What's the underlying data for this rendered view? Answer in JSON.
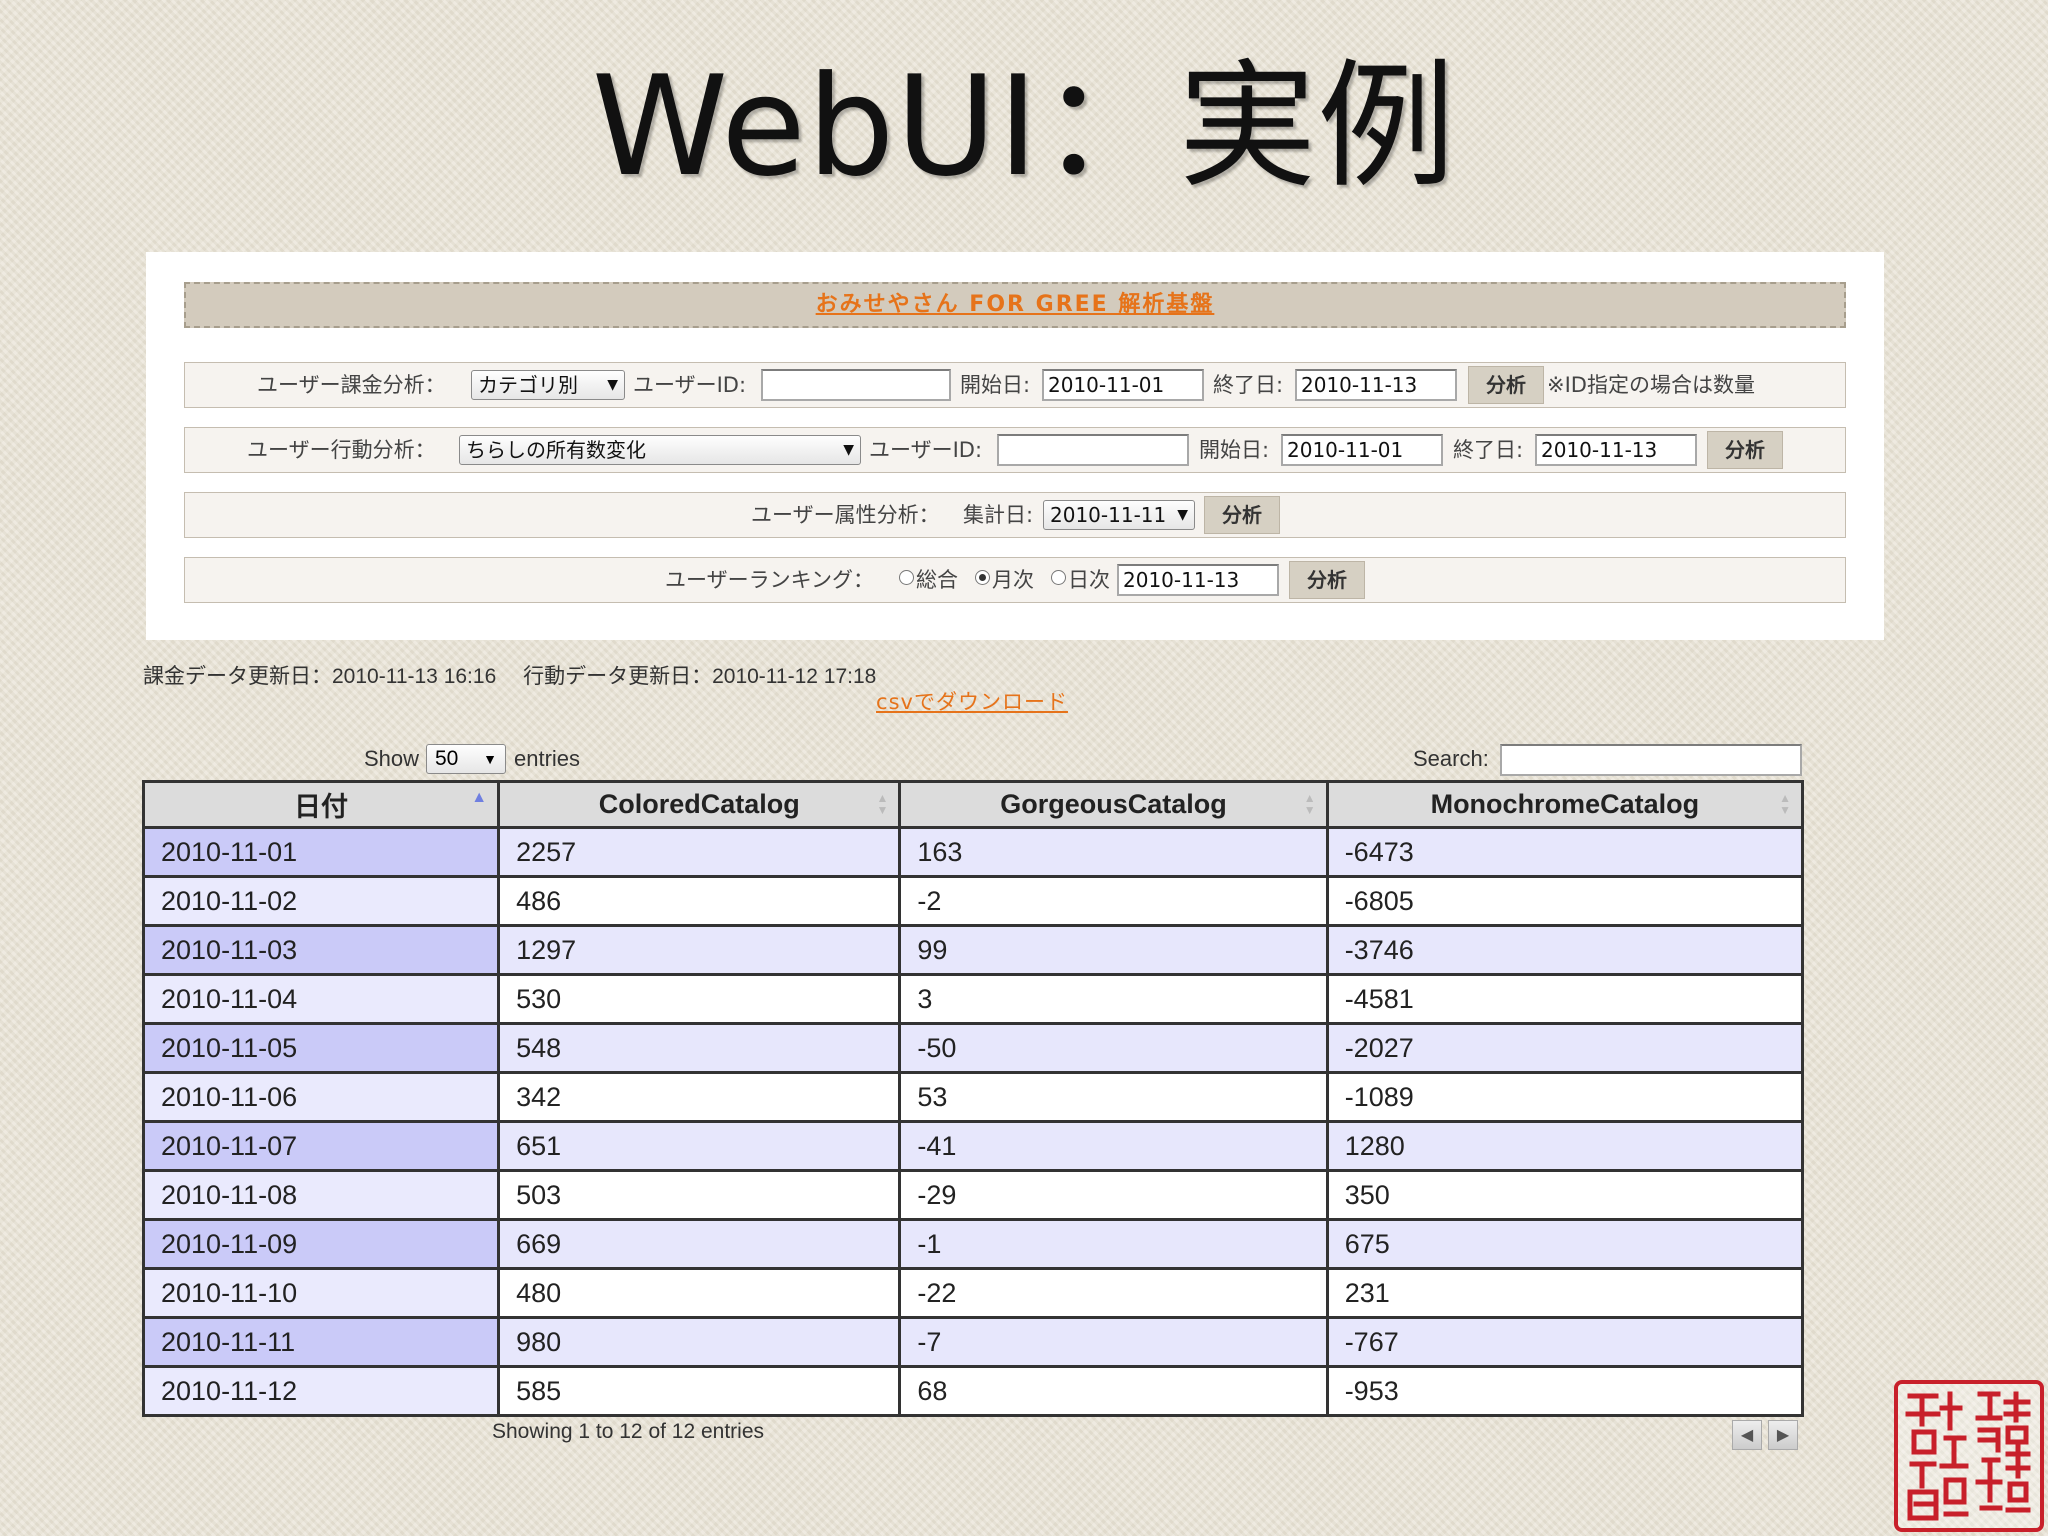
{
  "slide": {
    "title": "WebUI：実例"
  },
  "panel": {
    "header": "おみせやさん FOR GREE 解析基盤",
    "row1": {
      "label": "ユーザー課金分析：",
      "select": "カテゴリ別",
      "user_id_label": "ユーザーID:",
      "user_id_value": "",
      "start_label": "開始日:",
      "start_value": "2010-11-01",
      "end_label": "終了日:",
      "end_value": "2010-11-13",
      "button": "分析",
      "note": "※ID指定の場合は数量"
    },
    "row2": {
      "label": "ユーザー行動分析：",
      "select": "ちらしの所有数変化",
      "user_id_label": "ユーザーID:",
      "user_id_value": "",
      "start_label": "開始日:",
      "start_value": "2010-11-01",
      "end_label": "終了日:",
      "end_value": "2010-11-13",
      "button": "分析"
    },
    "row3": {
      "label": "ユーザー属性分析：",
      "date_label": "集計日:",
      "select": "2010-11-11",
      "button": "分析"
    },
    "row4": {
      "label": "ユーザーランキング：",
      "radio_total": "総合",
      "radio_monthly": "月次",
      "radio_daily": "日次",
      "selected": "月次",
      "date_value": "2010-11-13",
      "button": "分析"
    }
  },
  "updates": {
    "text": "課金データ更新日：2010-11-13 16:16　 行動データ更新日：2010-11-12 17:18"
  },
  "csv_link": "csvでダウンロード",
  "table_controls": {
    "show_label": "Show",
    "length_value": "50",
    "entries_label": "entries",
    "search_label": "Search:",
    "search_value": "",
    "info": "Showing 1 to 12 of 12 entries"
  },
  "table": {
    "columns": [
      "日付",
      "ColoredCatalog",
      "GorgeousCatalog",
      "MonochromeCatalog"
    ],
    "rows": [
      [
        "2010-11-01",
        "2257",
        "163",
        "-6473"
      ],
      [
        "2010-11-02",
        "486",
        "-2",
        "-6805"
      ],
      [
        "2010-11-03",
        "1297",
        "99",
        "-3746"
      ],
      [
        "2010-11-04",
        "530",
        "3",
        "-4581"
      ],
      [
        "2010-11-05",
        "548",
        "-50",
        "-2027"
      ],
      [
        "2010-11-06",
        "342",
        "53",
        "-1089"
      ],
      [
        "2010-11-07",
        "651",
        "-41",
        "1280"
      ],
      [
        "2010-11-08",
        "503",
        "-29",
        "350"
      ],
      [
        "2010-11-09",
        "669",
        "-1",
        "675"
      ],
      [
        "2010-11-10",
        "480",
        "-22",
        "231"
      ],
      [
        "2010-11-11",
        "980",
        "-7",
        "-767"
      ],
      [
        "2010-11-12",
        "585",
        "68",
        "-953"
      ]
    ]
  },
  "seal_text": "吉吉東京エンターテイメント研究所",
  "colors": {
    "accent_orange": "#e6731a",
    "header_bg": "#d3cbbd",
    "sorted_col": "#cacaf8",
    "odd_row": "#e7e7fc",
    "seal_red": "#c8202a"
  }
}
